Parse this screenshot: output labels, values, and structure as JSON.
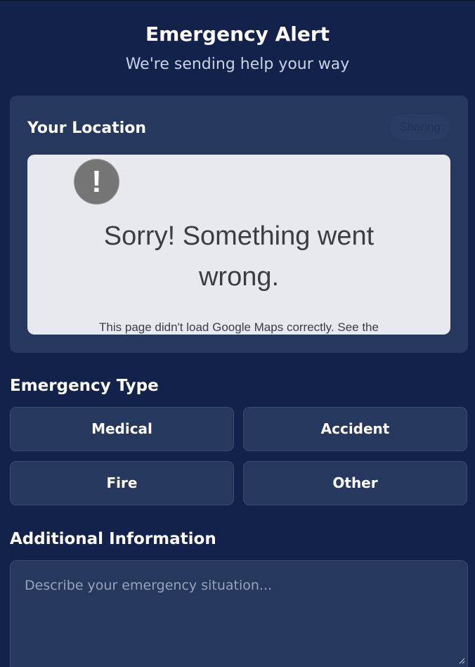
{
  "header": {
    "title": "Emergency Alert",
    "subtitle": "We're sending help your way"
  },
  "location": {
    "title": "Your Location",
    "status_badge": "Sharing",
    "map_error": {
      "icon_glyph": "!",
      "icon": "warning-icon",
      "title": "Sorry! Something went wrong.",
      "detail": "This page didn't load Google Maps correctly. See the"
    }
  },
  "emergency_type": {
    "title": "Emergency Type",
    "options": [
      "Medical",
      "Accident",
      "Fire",
      "Other"
    ]
  },
  "additional_info": {
    "title": "Additional Information",
    "placeholder": "Describe your emergency situation..."
  },
  "colors": {
    "background": "#13224a",
    "card": "#27385f",
    "map_bg": "#e8e9ee"
  }
}
